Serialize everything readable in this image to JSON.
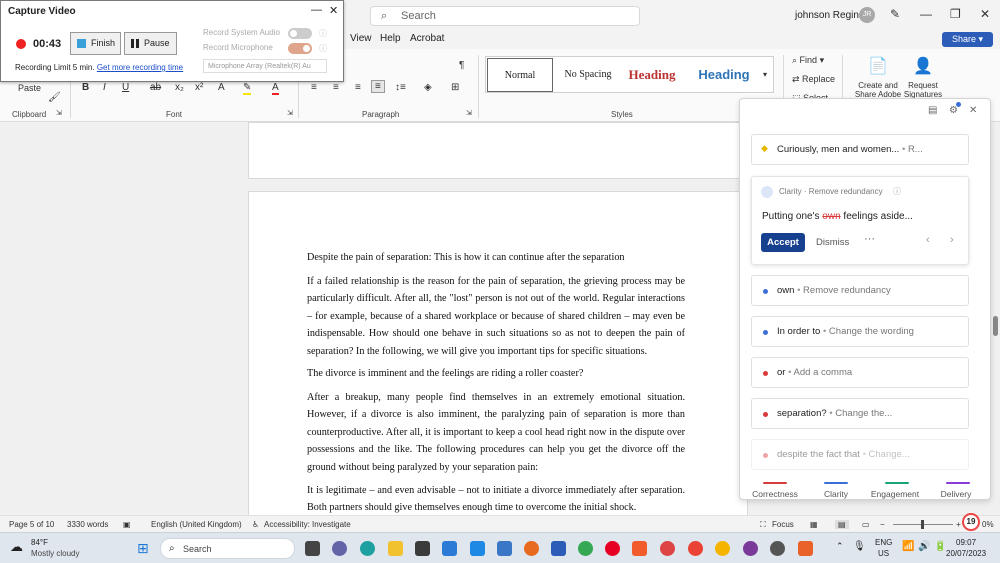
{
  "titlebar": {
    "search_placeholder": "Search",
    "user_name": "johnson Reginald",
    "avatar_initials": "JR"
  },
  "menu_tabs": [
    "View",
    "Help",
    "Acrobat"
  ],
  "share_label": "Share",
  "ribbon": {
    "paste_label": "Paste",
    "groups": [
      "Clipboard",
      "Font",
      "Paragraph",
      "Styles"
    ],
    "styles": [
      "Normal",
      "No Spacing",
      "Heading",
      "Heading"
    ],
    "editing": [
      "Find",
      "Replace",
      "Select"
    ],
    "acrobat": [
      "Create and Share Adobe PDF",
      "Request Signatures"
    ]
  },
  "capture": {
    "title": "Capture Video",
    "time": "00:43",
    "finish_label": "Finish",
    "pause_label": "Pause",
    "limit_text": "Recording Limit 5 min.",
    "limit_link": "Get more recording time",
    "opt_system_audio": "Record System Audio",
    "opt_microphone": "Record Microphone",
    "mic_device": "Microphone Array (Realtek(R) Au"
  },
  "document": {
    "paragraphs": [
      "Despite the pain of separation: This is how it can continue after the separation",
      "If a failed relationship is the reason for the pain of separation, the grieving process may be particularly difficult. After all, the \"lost\" person is not out of the world. Regular interactions – for example, because of a shared workplace or because of shared children – may even be indispensable. How should one behave in such situations so as not to deepen the pain of separation? In the following, we will give you important tips for specific situations.",
      "The divorce is imminent and the feelings are riding a roller coaster?",
      "After a breakup, many people find themselves in an extremely emotional situation. However, if a divorce is also imminent, the paralyzing pain of separation is more than counterproductive. After all, it is important to keep a cool head right now in the dispute over possessions and the like. The following procedures can help you get the divorce off the ground without being paralyzed by your separation pain:",
      "It is legitimate – and even advisable – not to initiate a divorce immediately after separation. Both partners should give themselves enough time to overcome the initial shock."
    ]
  },
  "grammarly": {
    "top_card": {
      "word": "Curiously, men and women...",
      "desc": "R..."
    },
    "expanded": {
      "category": "Clarity",
      "type": "Remove redundancy",
      "text_before": "Putting one's ",
      "strike": "own",
      "text_after": " feelings aside...",
      "accept_label": "Accept",
      "dismiss_label": "Dismiss"
    },
    "cards": [
      {
        "word": "own",
        "desc": "Remove redundancy",
        "color": "#3b6fd8"
      },
      {
        "word": "In order to",
        "desc": "Change the wording",
        "color": "#3b6fd8"
      },
      {
        "word": "or",
        "desc": "Add a comma",
        "color": "#d93a3a"
      },
      {
        "word": "separation?",
        "desc": "Change the...",
        "color": "#d93a3a"
      },
      {
        "word": "despite the fact that",
        "desc": "Change...",
        "color": "#d93a3a"
      }
    ],
    "tabs": [
      {
        "label": "Correctness",
        "color": "#d93a3a"
      },
      {
        "label": "Clarity",
        "color": "#3b6fd8"
      },
      {
        "label": "Engagement",
        "color": "#1aa37a"
      },
      {
        "label": "Delivery",
        "color": "#8a3bd8"
      }
    ],
    "score": "19"
  },
  "statusbar": {
    "page": "Page 5 of 10",
    "words": "3330 words",
    "language": "English (United Kingdom)",
    "accessibility": "Accessibility: Investigate",
    "focus": "Focus",
    "zoom": "0%"
  },
  "taskbar": {
    "weather_temp": "84°F",
    "weather_desc": "Mostly cloudy",
    "search_placeholder": "Search",
    "lang1": "ENG",
    "lang2": "US",
    "time": "09:07",
    "date": "20/07/2023"
  }
}
